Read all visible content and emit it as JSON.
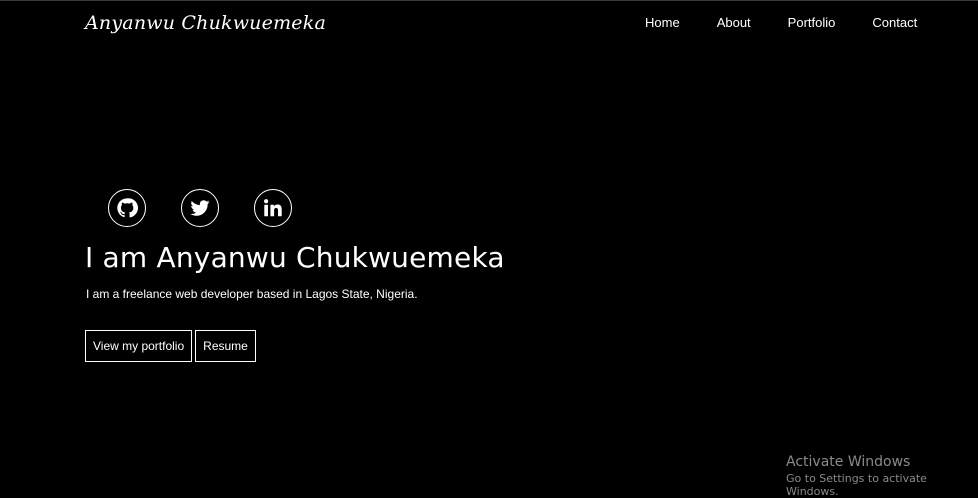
{
  "header": {
    "brand": "Anyanwu Chukwuemeka",
    "nav": [
      "Home",
      "About",
      "Portfolio",
      "Contact"
    ]
  },
  "socials": [
    {
      "name": "github-icon"
    },
    {
      "name": "twitter-icon"
    },
    {
      "name": "linkedin-icon"
    }
  ],
  "hero": {
    "title": "I am Anyanwu Chukwuemeka",
    "subtitle": "I am a freelance web developer based in Lagos State, Nigeria.",
    "buttons": [
      "View my portfolio",
      "Resume"
    ]
  },
  "watermark": {
    "title": "Activate Windows",
    "subtitle": "Go to Settings to activate Windows."
  },
  "colors": {
    "background": "#000000",
    "text": "#ffffff",
    "watermark": "#8a8a8a"
  }
}
